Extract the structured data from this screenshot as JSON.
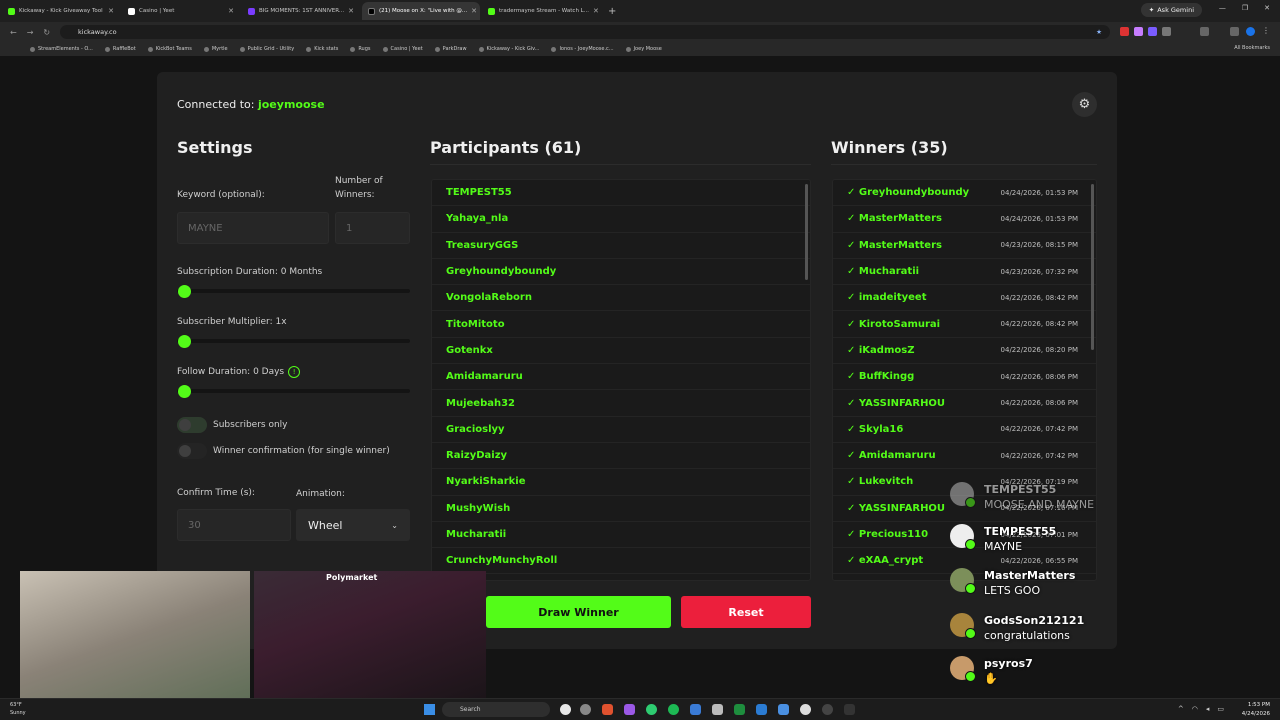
{
  "browser": {
    "tabs": [
      {
        "title": "Kickaway - Kick Giveaway Tool",
        "color": "#53fc18",
        "active": false
      },
      {
        "title": "Casino | Yeet",
        "color": "#ffffff",
        "active": false
      },
      {
        "title": "BIG MOMENTS: 1ST ANNIVER...",
        "color": "#7a3cff",
        "active": false
      },
      {
        "title": "(21) Moose on X: \"Live with @...",
        "color": "#000000",
        "active": true
      },
      {
        "title": "tradermayne Stream - Watch L...",
        "color": "#53fc18",
        "active": false
      }
    ],
    "ask_gemini": "Ask Gemini",
    "url": "kickaway.co",
    "bookmarks": [
      "StreamElements - O...",
      "RaffleBot",
      "KickBot Teams",
      "Myrtle",
      "Public Grid - Utility",
      "Kick stats",
      "Rugs",
      "Casino | Yeet",
      "ParkDraw",
      "Kickaway - Kick Giv...",
      "Ionos - JoeyMoose.c...",
      "Joey Moose"
    ],
    "all_bookmarks": "All Bookmarks"
  },
  "app": {
    "connected_label": "Connected to:",
    "connected_user": "joeymoose",
    "settings": {
      "title": "Settings",
      "keyword_label": "Keyword (optional):",
      "keyword_placeholder": "MAYNE",
      "winners_label_1": "Number of",
      "winners_label_2": "Winners:",
      "winners_placeholder": "1",
      "sub_duration_label": "Subscription Duration: 0 Months",
      "sub_multiplier_label": "Subscriber Multiplier: 1x",
      "follow_duration_label": "Follow Duration: 0  Days",
      "info_glyph": "!",
      "subscribers_only": "Subscribers only",
      "winner_confirmation": "Winner confirmation (for single winner)",
      "confirm_time_label": "Confirm Time (s):",
      "confirm_time_placeholder": "30",
      "animation_label": "Animation:",
      "animation_value": "Wheel"
    },
    "participants": {
      "title": "Participants (61)",
      "names": [
        "TEMPEST55",
        "Yahaya_nla",
        "TreasuryGGS",
        "Greyhoundyboundy",
        "VongolaReborn",
        "TitoMitoto",
        "Gotenkx",
        "Amidamaruru",
        "Mujeebah32",
        "Gracioslyy",
        "RaizyDaizy",
        "NyarkiSharkie",
        "MushyWish",
        "Mucharatii",
        "CrunchyMunchyRoll"
      ]
    },
    "winners": {
      "title": "Winners (35)",
      "check": "✓",
      "rows": [
        {
          "name": "Greyhoundyboundy",
          "date": "04/24/2026, 01:53 PM"
        },
        {
          "name": "MasterMatters",
          "date": "04/24/2026, 01:53 PM"
        },
        {
          "name": "MasterMatters",
          "date": "04/23/2026, 08:15 PM"
        },
        {
          "name": "Mucharatii",
          "date": "04/23/2026, 07:32 PM"
        },
        {
          "name": "imadeityeet",
          "date": "04/22/2026, 08:42 PM"
        },
        {
          "name": "KirotoSamurai",
          "date": "04/22/2026, 08:42 PM"
        },
        {
          "name": "iKadmosZ",
          "date": "04/22/2026, 08:20 PM"
        },
        {
          "name": "BuffKingg",
          "date": "04/22/2026, 08:06 PM"
        },
        {
          "name": "YASSINFARHOU",
          "date": "04/22/2026, 08:06 PM"
        },
        {
          "name": "Skyla16",
          "date": "04/22/2026, 07:42 PM"
        },
        {
          "name": "Amidamaruru",
          "date": "04/22/2026, 07:42 PM"
        },
        {
          "name": "Lukevitch",
          "date": "04/22/2026, 07:19 PM"
        },
        {
          "name": "YASSINFARHOU",
          "date": "04/22/2026, 07:16 PM"
        },
        {
          "name": "Precious110",
          "date": "04/22/2026, 07:01 PM"
        },
        {
          "name": "eXAA_crypt",
          "date": "04/22/2026, 06:55 PM"
        }
      ]
    },
    "draw_winner": "Draw Winner",
    "reset": "Reset"
  },
  "chat": [
    {
      "name": "TEMPEST55",
      "text": "MOOSE AND MAYNE"
    },
    {
      "name": "TEMPEST55",
      "text": "MAYNE"
    },
    {
      "name": "MasterMatters",
      "text": "LETS GOO"
    },
    {
      "name": "GodsSon212121",
      "text": "congratulations"
    },
    {
      "name": "psyros7",
      "text": ""
    }
  ],
  "webcam": {
    "overlay_text": "Polymarket"
  },
  "taskbar": {
    "weather_temp": "63°F",
    "weather_desc": "Sunny",
    "search_placeholder": "Search",
    "time": "1:53 PM",
    "date": "4/24/2026"
  },
  "colors": {
    "kick_green": "#53fc18",
    "reset_red": "#ec1f3c"
  }
}
